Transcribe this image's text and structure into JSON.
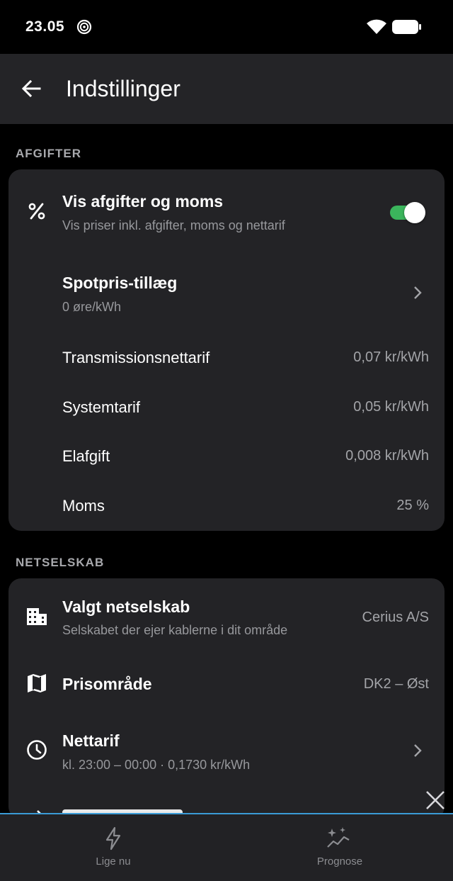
{
  "status_bar": {
    "time": "23.05"
  },
  "app_bar": {
    "title": "Indstillinger"
  },
  "sections": {
    "fees": {
      "header": "AFGIFTER",
      "show_fees": {
        "title": "Vis afgifter og moms",
        "subtitle": "Vis priser inkl. afgifter, moms og nettarif",
        "enabled": true
      },
      "spot_markup": {
        "title": "Spotpris-tillæg",
        "subtitle": "0 øre/kWh"
      },
      "rows": [
        {
          "label": "Transmissionsnettarif",
          "value": "0,07 kr/kWh"
        },
        {
          "label": "Systemtarif",
          "value": "0,05 kr/kWh"
        },
        {
          "label": "Elafgift",
          "value": "0,008 kr/kWh"
        },
        {
          "label": "Moms",
          "value": "25 %"
        }
      ]
    },
    "grid": {
      "header": "NETSELSKAB",
      "company": {
        "title": "Valgt netselskab",
        "subtitle": "Selskabet der ejer kablerne i dit område",
        "value": "Cerius A/S"
      },
      "price_area": {
        "title": "Prisområde",
        "value": "DK2 – Øst"
      },
      "net_tariff": {
        "title": "Nettarif",
        "subtitle": "kl. 23:00 – 00:00 · 0,1730 kr/kWh"
      }
    }
  },
  "bottom_nav": {
    "items": [
      {
        "label": "Lige nu",
        "icon": "lightning-icon"
      },
      {
        "label": "Prognose",
        "icon": "sparkle-chart-icon"
      }
    ]
  },
  "colors": {
    "background": "#000000",
    "card": "#232326",
    "app_bar": "#242427",
    "toggle_on": "#3bb55c",
    "nav_accent": "#3a9bd6"
  }
}
